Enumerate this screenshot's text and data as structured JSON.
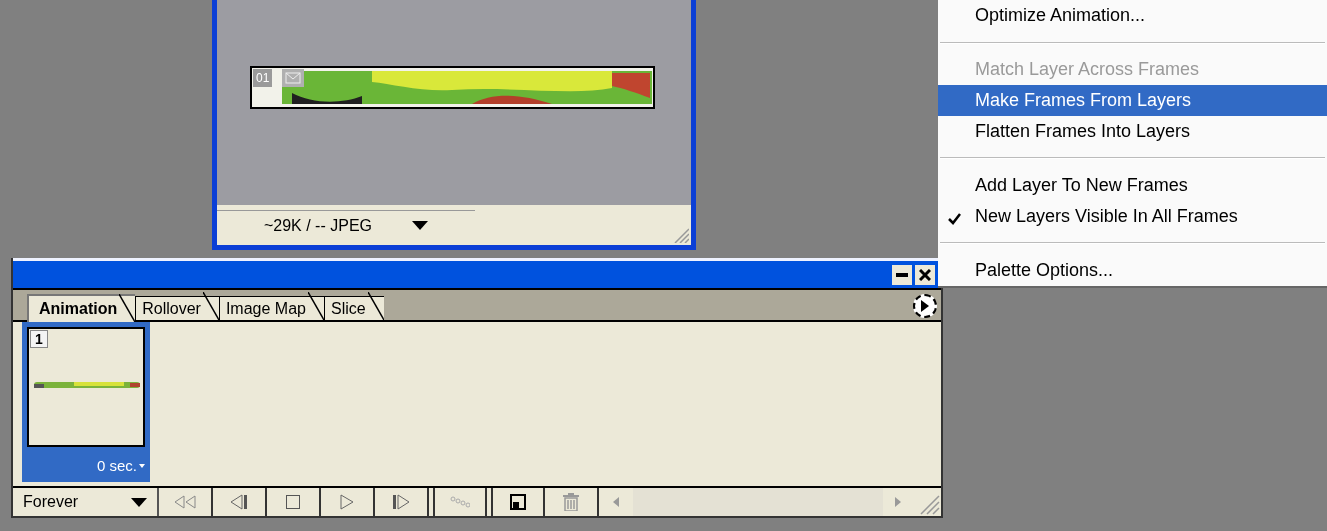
{
  "document_window": {
    "image_label": "01",
    "size_info": "~29K / -- JPEG"
  },
  "palette": {
    "tabs": [
      {
        "label": "Animation",
        "selected": true
      },
      {
        "label": "Rollover",
        "selected": false
      },
      {
        "label": "Image Map",
        "selected": false
      },
      {
        "label": "Slice",
        "selected": false
      }
    ],
    "frames": [
      {
        "number": "1",
        "delay": "0 sec.",
        "selected": true
      }
    ],
    "loop": "Forever"
  },
  "menu": {
    "items": [
      {
        "kind": "item",
        "label": "Optimize Animation...",
        "disabled": false,
        "selected": false,
        "checked": false
      },
      {
        "kind": "separator"
      },
      {
        "kind": "item",
        "label": "Match Layer Across Frames",
        "disabled": true,
        "selected": false,
        "checked": false
      },
      {
        "kind": "item",
        "label": "Make Frames From Layers",
        "disabled": false,
        "selected": true,
        "checked": false
      },
      {
        "kind": "item",
        "label": "Flatten Frames Into Layers",
        "disabled": false,
        "selected": false,
        "checked": false
      },
      {
        "kind": "separator"
      },
      {
        "kind": "item",
        "label": "Add Layer To New Frames",
        "disabled": false,
        "selected": false,
        "checked": false
      },
      {
        "kind": "item",
        "label": "New Layers Visible In All Frames",
        "disabled": false,
        "selected": false,
        "checked": true
      },
      {
        "kind": "separator"
      },
      {
        "kind": "item",
        "label": "Palette Options...",
        "disabled": false,
        "selected": false,
        "checked": false
      }
    ]
  }
}
